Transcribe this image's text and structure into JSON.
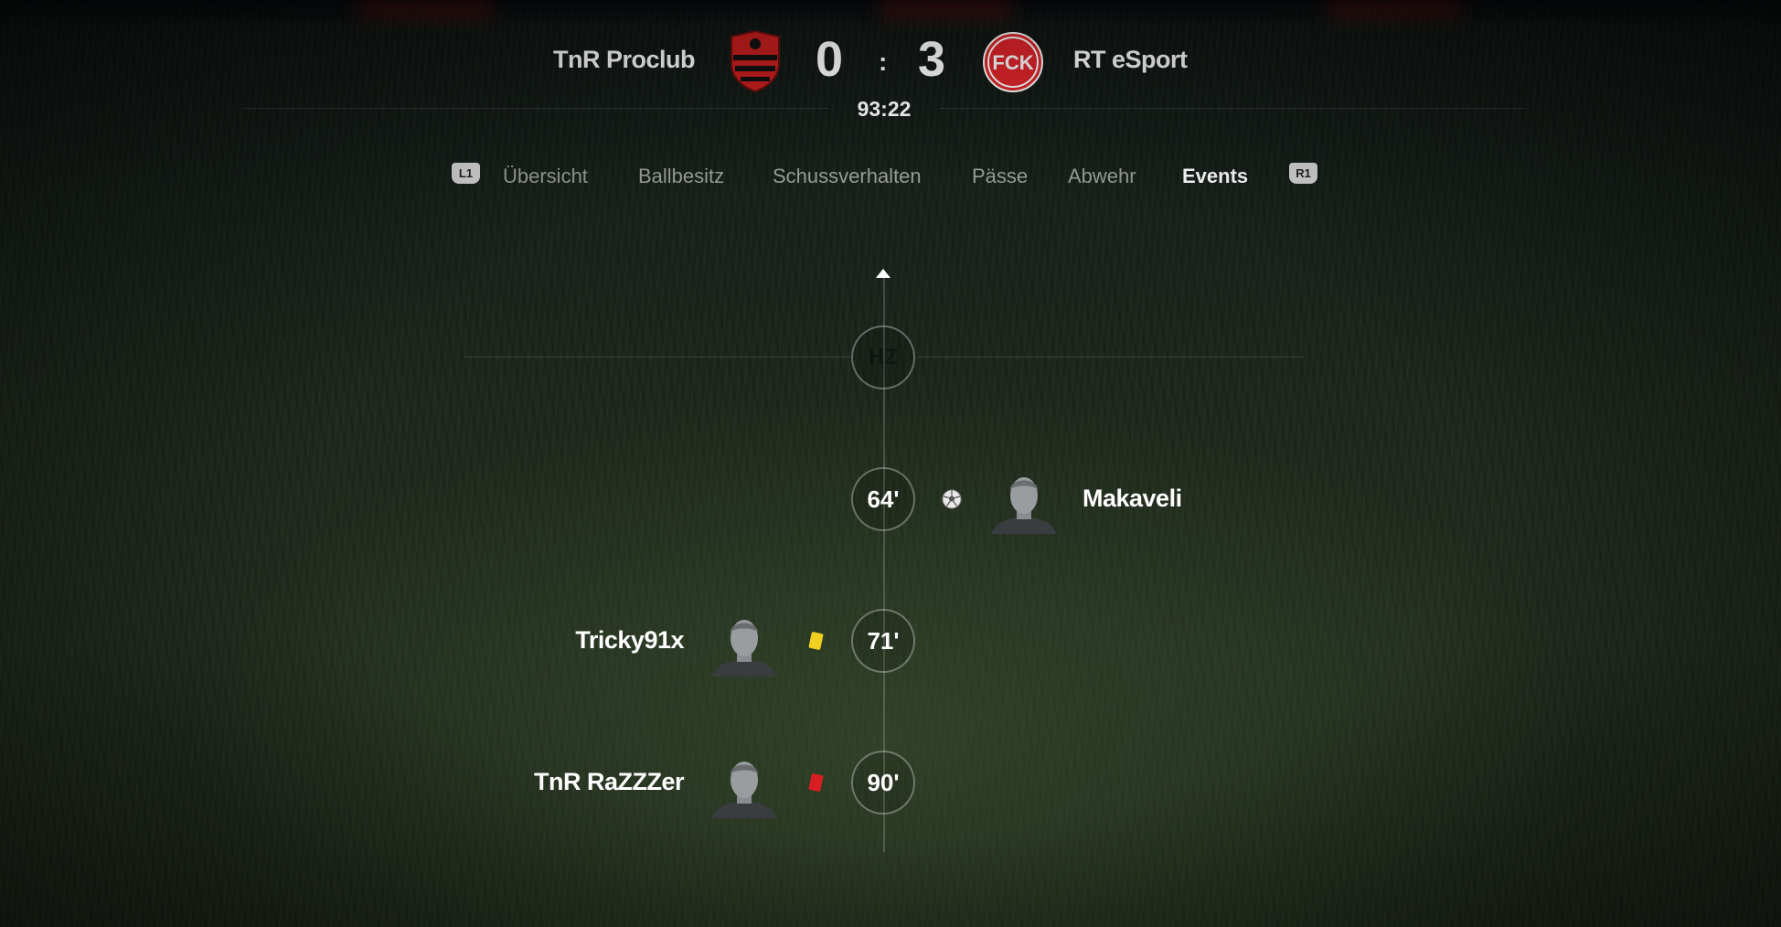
{
  "match": {
    "home_team": "TnR Proclub",
    "away_team": "RT eSport",
    "home_score": "0",
    "away_score": "3",
    "separator": ":",
    "clock": "93:22",
    "home_crest_color": "#d42a2a",
    "away_crest_color": "#e0252b",
    "away_crest_text": "FCK"
  },
  "tabs": {
    "left_shoulder": "L1",
    "right_shoulder": "R1",
    "items": [
      {
        "label": "Übersicht",
        "active": false
      },
      {
        "label": "Ballbesitz",
        "active": false
      },
      {
        "label": "Schussverhalten",
        "active": false
      },
      {
        "label": "Pässe",
        "active": false
      },
      {
        "label": "Abwehr",
        "active": false
      },
      {
        "label": "Events",
        "active": true
      }
    ]
  },
  "timeline": {
    "halftime_label": "HZ",
    "events": [
      {
        "minute": "64'",
        "side": "away",
        "type": "goal",
        "icon": "soccer-ball-icon",
        "player": "Makaveli"
      },
      {
        "minute": "71'",
        "side": "home",
        "type": "yellow-card",
        "icon": "yellow-card-icon",
        "player": "Tricky91x",
        "color": "#f0d020"
      },
      {
        "minute": "90'",
        "side": "home",
        "type": "red-card",
        "icon": "red-card-icon",
        "player": "TnR RaZZZer",
        "color": "#d81e22"
      }
    ]
  }
}
